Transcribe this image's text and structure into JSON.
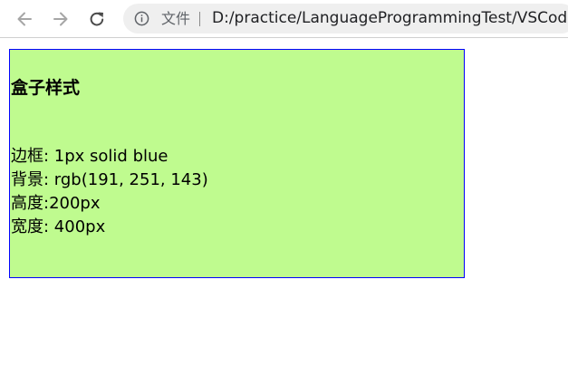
{
  "browser": {
    "scheme_label": "文件",
    "url": "D:/practice/LanguageProgrammingTest/VSCode"
  },
  "page": {
    "heading": "盒子样式",
    "lines": [
      "边框: 1px solid blue",
      "背景: rgb(191, 251, 143)",
      "高度:200px",
      "宽度: 400px"
    ]
  },
  "colors": {
    "box_background": "#bffb8f",
    "box_border": "#0000ff"
  }
}
